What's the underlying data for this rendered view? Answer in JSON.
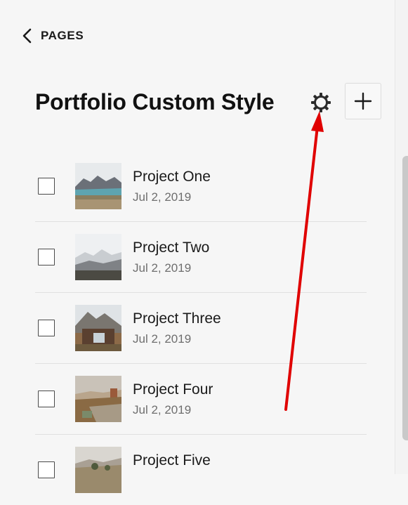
{
  "header": {
    "back_label": "PAGES",
    "title": "Portfolio Custom Style"
  },
  "icons": {
    "back": "chevron-left-icon",
    "settings": "gear-icon",
    "add": "plus-icon"
  },
  "items": [
    {
      "title": "Project One",
      "date": "Jul 2, 2019",
      "thumbnail": "lake-mountains"
    },
    {
      "title": "Project Two",
      "date": "Jul 2, 2019",
      "thumbnail": "misty-hills"
    },
    {
      "title": "Project Three",
      "date": "Jul 2, 2019",
      "thumbnail": "cabin-mountain"
    },
    {
      "title": "Project Four",
      "date": "Jul 2, 2019",
      "thumbnail": "desert-steps"
    },
    {
      "title": "Project Five",
      "date": "",
      "thumbnail": "hill-trees"
    }
  ],
  "annotation": {
    "arrow_color": "#e00000",
    "points_to": "gear-icon"
  }
}
